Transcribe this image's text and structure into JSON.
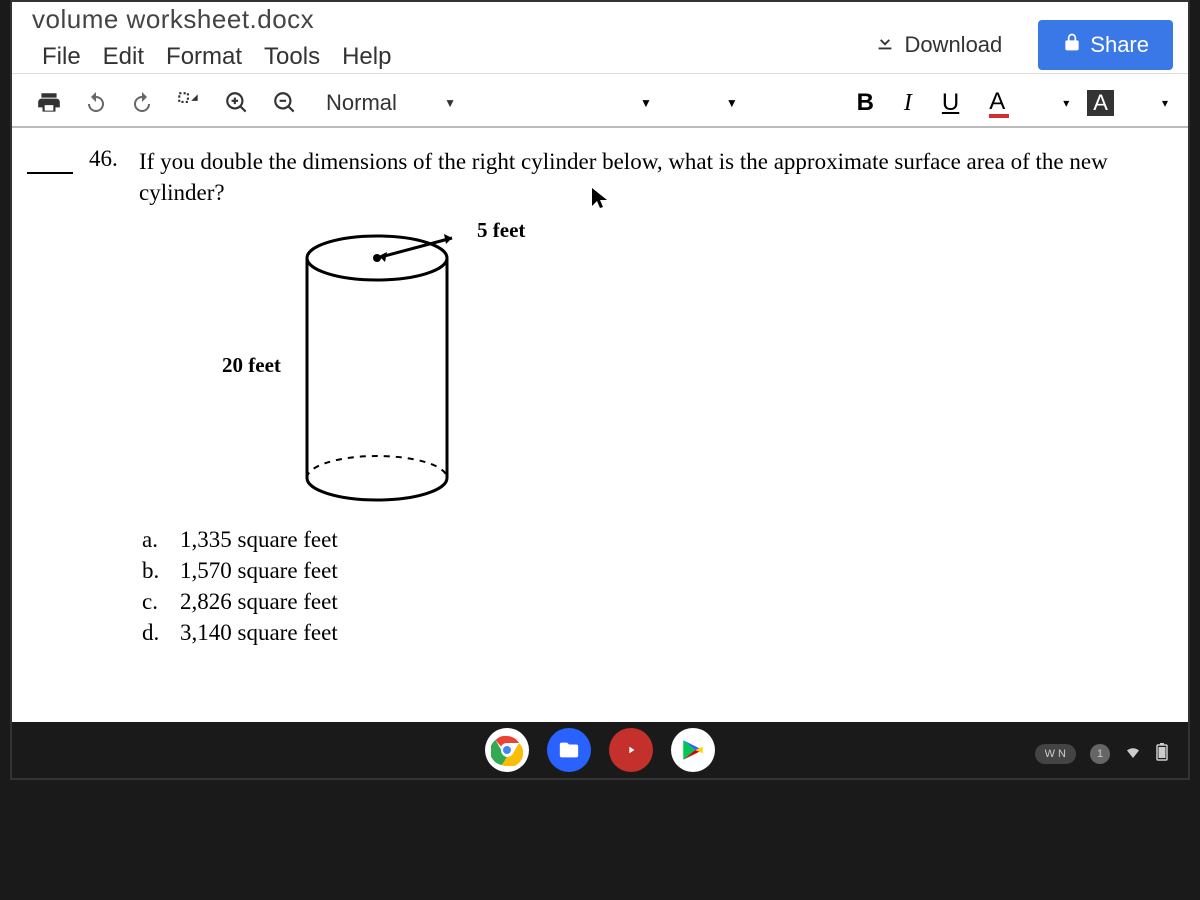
{
  "title": "volume worksheet.docx",
  "menubar": [
    "File",
    "Edit",
    "Format",
    "Tools",
    "Help"
  ],
  "actions": {
    "download": "Download",
    "share": "Share"
  },
  "toolbar": {
    "style": "Normal",
    "bold": "B",
    "italic": "I",
    "underline": "U",
    "textcolor": "A",
    "highlight": "A"
  },
  "question": {
    "number": "46.",
    "text": "If you double the dimensions of the right cylinder below, what is the approximate surface area of the new cylinder?",
    "radius_label": "5 feet",
    "height_label": "20 feet",
    "answers": [
      {
        "letter": "a.",
        "text": "1,335 square feet"
      },
      {
        "letter": "b.",
        "text": "1,570 square feet"
      },
      {
        "letter": "c.",
        "text": "2,826 square feet"
      },
      {
        "letter": "d.",
        "text": "3,140 square feet"
      }
    ]
  },
  "status": {
    "lang": "W N",
    "notif": "1"
  }
}
